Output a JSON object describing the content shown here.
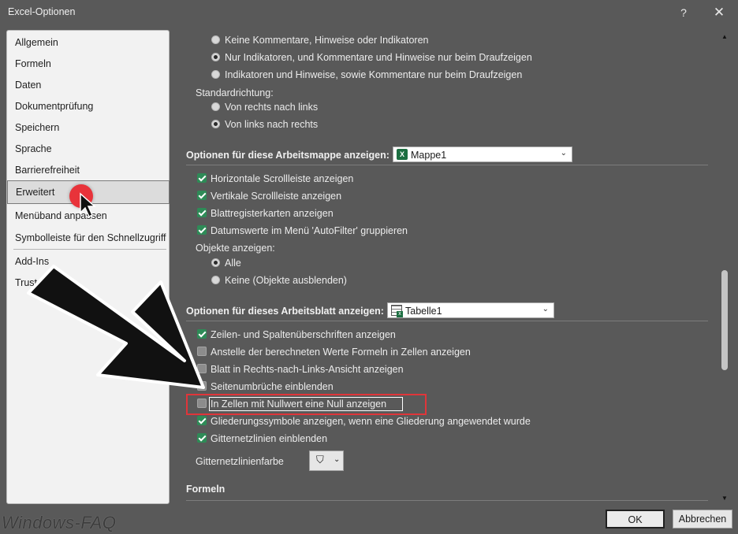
{
  "window": {
    "title": "Excel-Optionen",
    "help_glyph": "?",
    "close_glyph": "✕"
  },
  "sidebar": {
    "items": [
      {
        "label": "Allgemein"
      },
      {
        "label": "Formeln"
      },
      {
        "label": "Daten"
      },
      {
        "label": "Dokumentprüfung"
      },
      {
        "label": "Speichern"
      },
      {
        "label": "Sprache"
      },
      {
        "label": "Barrierefreiheit"
      },
      {
        "label": "Erweitert",
        "selected": true
      },
      {
        "label": "Menüband anpassen"
      },
      {
        "label": "Symbolleiste für den Schnellzugriff"
      },
      {
        "label": "Add-Ins"
      },
      {
        "label": "Trust Center"
      }
    ],
    "visible_labels": {
      "menueband": "Menüband anpa",
      "menueband_tail": "ssen",
      "trust": "Trust"
    }
  },
  "comments_group": {
    "options": [
      {
        "label": "Keine Kommentare, Hinweise oder Indikatoren",
        "selected": false
      },
      {
        "label": "Nur Indikatoren, und Kommentare und Hinweise nur beim Draufzeigen",
        "selected": true
      },
      {
        "label": "Indikatoren und Hinweise, sowie Kommentare nur beim Draufzeigen",
        "selected": false
      }
    ]
  },
  "direction_group": {
    "label": "Standardrichtung:",
    "options": [
      {
        "label": "Von rechts nach links",
        "selected": false
      },
      {
        "label": "Von links nach rechts",
        "selected": true
      }
    ]
  },
  "workbook_section": {
    "title": "Optionen für diese Arbeitsmappe anzeigen:",
    "dropdown_value": "Mappe1",
    "icon": "excel-workbook-icon",
    "checkboxes": [
      {
        "label": "Horizontale Scrollleiste anzeigen",
        "checked": true
      },
      {
        "label": "Vertikale Scrollleiste anzeigen",
        "checked": true
      },
      {
        "label": "Blattregisterkarten anzeigen",
        "checked": true
      },
      {
        "label": "Datumswerte im Menü 'AutoFilter' gruppieren",
        "checked": true
      }
    ],
    "objects_label": "Objekte anzeigen:",
    "objects_options": [
      {
        "label": "Alle",
        "selected": true
      },
      {
        "label": "Keine (Objekte ausblenden)",
        "selected": false
      }
    ]
  },
  "sheet_section": {
    "title": "Optionen für dieses Arbeitsblatt anzeigen:",
    "dropdown_value": "Tabelle1",
    "icon": "worksheet-icon",
    "checkboxes": [
      {
        "label": "Zeilen- und Spaltenüberschriften anzeigen",
        "checked": true
      },
      {
        "label": "Anstelle der berechneten Werte Formeln in Zellen anzeigen",
        "checked": false
      },
      {
        "label": "Blatt in Rechts-nach-Links-Ansicht anzeigen",
        "checked": false
      },
      {
        "label": "Seitenumbrüche einblenden",
        "checked": false
      },
      {
        "label": "In Zellen mit Nullwert eine Null anzeigen",
        "checked": false,
        "highlighted": true
      },
      {
        "label": "Gliederungssymbole anzeigen, wenn eine Gliederung angewendet wurde",
        "checked": true
      },
      {
        "label": "Gitternetzlinien einblenden",
        "checked": true
      }
    ],
    "gridline_color_label": "Gitternetzlinienfarbe",
    "gridline_color_icon": "paint-bucket-icon"
  },
  "formulas_section": {
    "title": "Formeln"
  },
  "footer": {
    "ok_label": "OK",
    "cancel_label": "Abbrechen"
  },
  "watermark": "Windows-FAQ",
  "colors": {
    "background": "#595959",
    "sidebar": "#f2f2f2",
    "checkbox_on": "#2e8b57",
    "highlight_border": "#e0353a",
    "cursor_dot": "#e8333a"
  }
}
